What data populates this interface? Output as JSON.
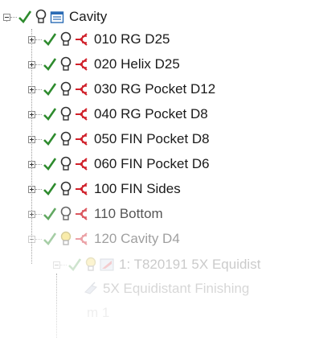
{
  "tree": {
    "root": {
      "label": "Cavity",
      "expanded": true
    },
    "operations": [
      {
        "label": "010 RG D25"
      },
      {
        "label": "020 Helix D25"
      },
      {
        "label": "030 RG Pocket D12"
      },
      {
        "label": "040 RG Pocket D8"
      },
      {
        "label": "050 FIN Pocket D8"
      },
      {
        "label": "060 FIN Pocket D6"
      },
      {
        "label": "100 FIN Sides"
      },
      {
        "label": "110 Bottom"
      },
      {
        "label": "120 Cavity D4",
        "expanded": true
      }
    ],
    "child_tool": {
      "label": "1: T820191 5X Equidist"
    },
    "child_strategy": {
      "label": "5X Equidistant Finishing"
    },
    "child_partial": {
      "label": "m 1"
    }
  },
  "colors": {
    "check": "#2e8b2e",
    "bulb_on": "#f2d43a",
    "operation_icon": "#d0202a"
  }
}
